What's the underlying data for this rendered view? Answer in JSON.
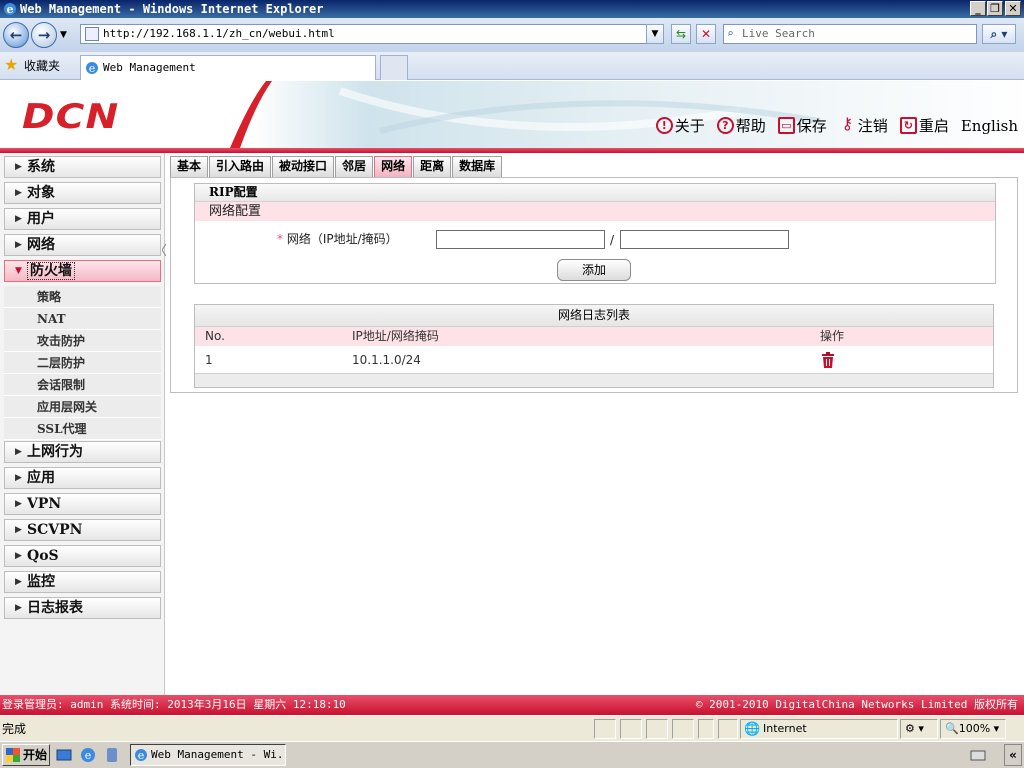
{
  "window": {
    "title": "Web Management - Windows Internet Explorer"
  },
  "browser": {
    "address": "http://192.168.1.1/zh_cn/webui.html",
    "search_placeholder": "Live Search",
    "favorites_label": "收藏夹",
    "tab_title": "Web Management"
  },
  "header": {
    "logo": "DCN",
    "nav": [
      {
        "label": "关于",
        "icon": "info-icon"
      },
      {
        "label": "帮助",
        "icon": "help-icon"
      },
      {
        "label": "保存",
        "icon": "save-icon"
      },
      {
        "label": "注销",
        "icon": "key-icon"
      },
      {
        "label": "重启",
        "icon": "restart-icon"
      },
      {
        "label": "English",
        "icon": ""
      }
    ],
    "accent_color": "#c8102e"
  },
  "sidebar": {
    "items": [
      {
        "label": "系统"
      },
      {
        "label": "对象"
      },
      {
        "label": "用户"
      },
      {
        "label": "网络"
      },
      {
        "label": "防火墙"
      },
      {
        "label": "上网行为"
      },
      {
        "label": "应用"
      },
      {
        "label": "VPN"
      },
      {
        "label": "SCVPN"
      },
      {
        "label": "QoS"
      },
      {
        "label": "监控"
      },
      {
        "label": "日志报表"
      }
    ],
    "open_index": 4,
    "submenu": [
      "策略",
      "NAT",
      "攻击防护",
      "二层防护",
      "会话限制",
      "应用层网关",
      "SSL代理"
    ]
  },
  "tabs": [
    "基本",
    "引入路由",
    "被动接口",
    "邻居",
    "网络",
    "距离",
    "数据库"
  ],
  "active_tab": 4,
  "rip": {
    "section_title": "RIP配置",
    "subsection": "网络配置",
    "field_required": "*",
    "field_label": "网络（IP地址/掩码）",
    "separator": "/",
    "ip_value": "",
    "mask_value": "",
    "add_button": "添加"
  },
  "network_table": {
    "title": "网络日志列表",
    "columns": [
      "No.",
      "IP地址/网络掩码",
      "操作"
    ],
    "rows": [
      {
        "no": "1",
        "network": "10.1.1.0/24"
      }
    ]
  },
  "app_status": {
    "left": "登录管理员: admin 系统时间: 2013年3月16日 星期六 12:18:10",
    "right": "© 2001-2010 DigitalChina Networks Limited 版权所有"
  },
  "ie_status": {
    "done": "完成",
    "zone": "Internet",
    "zoom": "100%"
  },
  "taskbar": {
    "start": "开始",
    "task_title": "Web Management - Wi..."
  }
}
